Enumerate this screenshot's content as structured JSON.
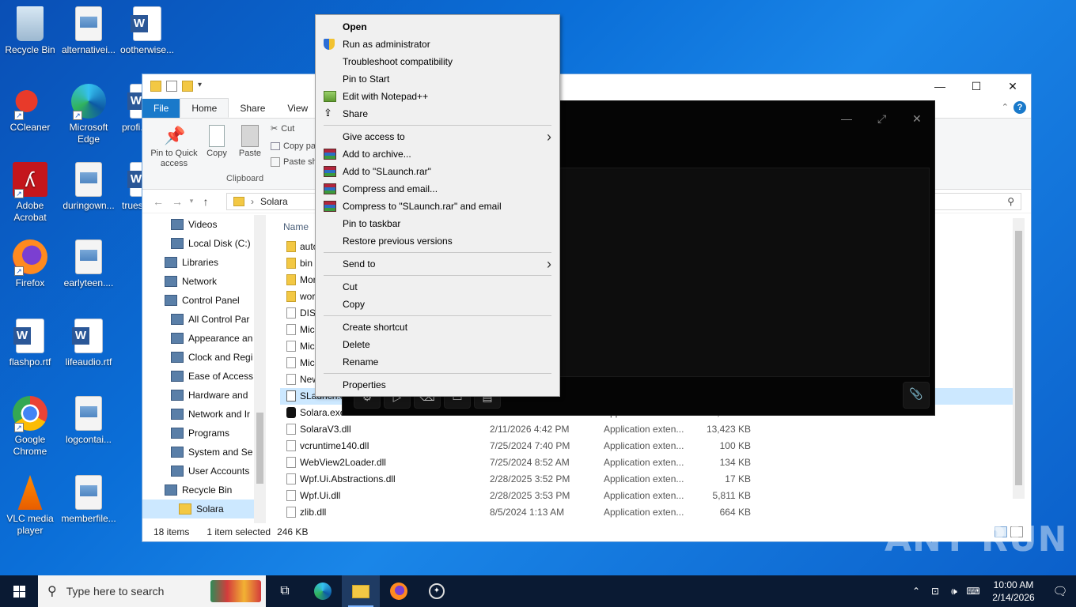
{
  "desktop": {
    "icons": [
      {
        "label": "Recycle Bin"
      },
      {
        "label": "alternativei..."
      },
      {
        "label": "ootherwise..."
      },
      {
        "label": "CCleaner"
      },
      {
        "label": "Microsoft Edge"
      },
      {
        "label": "profi..."
      },
      {
        "label": "Adobe Acrobat"
      },
      {
        "label": "duringown..."
      },
      {
        "label": "trues..."
      },
      {
        "label": "Firefox"
      },
      {
        "label": "earlyteen...."
      },
      {
        "label": "flashpo.rtf"
      },
      {
        "label": "lifeaudio.rtf"
      },
      {
        "label": "Google Chrome"
      },
      {
        "label": "logcontai..."
      },
      {
        "label": "VLC media player"
      },
      {
        "label": "memberfile..."
      }
    ]
  },
  "explorer": {
    "ribbon_tabs": [
      "File",
      "Home",
      "Share",
      "View"
    ],
    "ribbon": {
      "pin_quick_access": "Pin to Quick access",
      "copy": "Copy",
      "paste": "Paste",
      "cut": "Cut",
      "copy_path": "Copy pa",
      "paste_shortcut": "Paste sh",
      "clipboard_group": "Clipboard"
    },
    "address": {
      "path": "Solara"
    },
    "nav": [
      {
        "label": "Videos"
      },
      {
        "label": "Local Disk (C:)"
      },
      {
        "label": "Libraries"
      },
      {
        "label": "Network"
      },
      {
        "label": "Control Panel"
      },
      {
        "label": "All Control Par"
      },
      {
        "label": "Appearance an"
      },
      {
        "label": "Clock and Regi"
      },
      {
        "label": "Ease of Access"
      },
      {
        "label": "Hardware and"
      },
      {
        "label": "Network and Ir"
      },
      {
        "label": "Programs"
      },
      {
        "label": "System and Se"
      },
      {
        "label": "User Accounts"
      },
      {
        "label": "Recycle Bin"
      },
      {
        "label": "Solara"
      }
    ],
    "column_name": "Name",
    "files": [
      {
        "name": "auto",
        "date": "",
        "type": "",
        "size": "",
        "kind": "folder"
      },
      {
        "name": "bin",
        "date": "",
        "type": "",
        "size": "",
        "kind": "folder"
      },
      {
        "name": "Mor",
        "date": "",
        "type": "",
        "size": "",
        "kind": "folder"
      },
      {
        "name": "wor",
        "date": "",
        "type": "",
        "size": "",
        "kind": "folder"
      },
      {
        "name": "DISC",
        "date": "",
        "type": "",
        "size": "",
        "kind": "file"
      },
      {
        "name": "Mic",
        "date": "",
        "type": "",
        "size": "",
        "kind": "file"
      },
      {
        "name": "Mic",
        "date": "",
        "type": "",
        "size": "",
        "kind": "file"
      },
      {
        "name": "Mic",
        "date": "",
        "type": "",
        "size": "",
        "kind": "file"
      },
      {
        "name": "New",
        "date": "",
        "type": "",
        "size": "",
        "kind": "file"
      },
      {
        "name": "SLaunch.e",
        "date": "",
        "type": "",
        "size": "",
        "kind": "exe"
      },
      {
        "name": "Solara.exe",
        "date": "2/1/2026 4:01 PM",
        "type": "Application",
        "size": "1,274 KB",
        "kind": "app"
      },
      {
        "name": "SolaraV3.dll",
        "date": "2/11/2026 4:42 PM",
        "type": "Application exten...",
        "size": "13,423 KB",
        "kind": "file"
      },
      {
        "name": "vcruntime140.dll",
        "date": "7/25/2024 7:40 PM",
        "type": "Application exten...",
        "size": "100 KB",
        "kind": "file"
      },
      {
        "name": "WebView2Loader.dll",
        "date": "7/25/2024 8:52 AM",
        "type": "Application exten...",
        "size": "134 KB",
        "kind": "file"
      },
      {
        "name": "Wpf.Ui.Abstractions.dll",
        "date": "2/28/2025 3:52 PM",
        "type": "Application exten...",
        "size": "17 KB",
        "kind": "file"
      },
      {
        "name": "Wpf.Ui.dll",
        "date": "2/28/2025 3:53 PM",
        "type": "Application exten...",
        "size": "5,811 KB",
        "kind": "file"
      },
      {
        "name": "zlib.dll",
        "date": "8/5/2024 1:13 AM",
        "type": "Application exten...",
        "size": "664 KB",
        "kind": "file"
      }
    ],
    "status": {
      "count": "18 items",
      "selected": "1 item selected",
      "size": "246 KB"
    }
  },
  "context_menu": {
    "items": [
      {
        "label": "Open",
        "bold": true
      },
      {
        "label": "Run as administrator",
        "icon": "shield-icon"
      },
      {
        "label": "Troubleshoot compatibility"
      },
      {
        "label": "Pin to Start"
      },
      {
        "label": "Edit with Notepad++",
        "icon": "notepad-icon"
      },
      {
        "label": "Share",
        "icon": "share-icon"
      },
      {
        "sep": true
      },
      {
        "label": "Give access to",
        "submenu": true
      },
      {
        "label": "Add to archive...",
        "icon": "winrar-icon"
      },
      {
        "label": "Add to \"SLaunch.rar\"",
        "icon": "winrar-icon"
      },
      {
        "label": "Compress and email...",
        "icon": "winrar-icon"
      },
      {
        "label": "Compress to \"SLaunch.rar\" and email",
        "icon": "winrar-icon"
      },
      {
        "label": "Pin to taskbar"
      },
      {
        "label": "Restore previous versions"
      },
      {
        "sep": true
      },
      {
        "label": "Send to",
        "submenu": true
      },
      {
        "sep": true
      },
      {
        "label": "Cut"
      },
      {
        "label": "Copy"
      },
      {
        "sep": true
      },
      {
        "label": "Create shortcut"
      },
      {
        "label": "Delete"
      },
      {
        "label": "Rename"
      },
      {
        "sep": true
      },
      {
        "label": "Properties"
      }
    ]
  },
  "taskbar": {
    "search_placeholder": "Type here to search",
    "time": "10:00 AM",
    "date": "2/14/2026"
  },
  "watermark": "ANY RUN",
  "colors": {
    "accent": "#1979ca",
    "selection": "#cce8ff",
    "taskbar": "#0a1a33"
  }
}
